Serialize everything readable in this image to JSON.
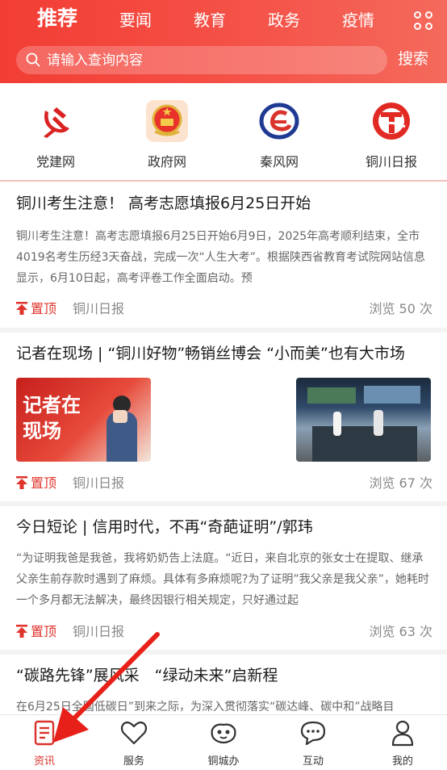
{
  "header": {
    "tabs": [
      {
        "label": "推荐",
        "active": true
      },
      {
        "label": "要闻"
      },
      {
        "label": "教育"
      },
      {
        "label": "政务"
      },
      {
        "label": "疫情"
      }
    ],
    "menu_icon": "grid-icon",
    "search": {
      "placeholder": "请输入查询内容",
      "button_label": "搜索"
    },
    "brand_color": "#f23d34"
  },
  "quick_links": [
    {
      "label": "党建网",
      "icon": "party-emblem-icon"
    },
    {
      "label": "政府网",
      "icon": "national-emblem-icon"
    },
    {
      "label": "秦风网",
      "icon": "qinfeng-logo-icon"
    },
    {
      "label": "铜川日报",
      "icon": "tongchuan-daily-logo-icon"
    }
  ],
  "articles": [
    {
      "title": "铜川考生注意！ 高考志愿填报6月25日开始",
      "summary": "铜川考生注意！高考志愿填报6月25日开始6月9日，2025年高考顺利结束，全市4019名考生历经3天奋战，完成一次“人生大考”。根据陕西省教育考试院网站信息显示，6月10日起，高考评卷工作全面启动。预",
      "pin_label": "置顶",
      "source": "铜川日报",
      "views": "浏览 50 次"
    },
    {
      "title": "记者在现场 | “铜川好物”畅销丝博会 “小而美”也有大市场",
      "image_caption": "记者在现场",
      "pin_label": "置顶",
      "source": "铜川日报",
      "views": "浏览 67 次"
    },
    {
      "title": "今日短论 | 信用时代，不再“奇葩证明”/郭玮",
      "summary": "“为证明我爸是我爸，我将奶奶告上法庭。“近日，来自北京的张女士在提取、继承父亲生前存款时遇到了麻烦。具体有多麻烦呢?为了证明”我父亲是我父亲”，她耗时一个多月都无法解决，最终因银行相关规定，只好通过起",
      "pin_label": "置顶",
      "source": "铜川日报",
      "views": "浏览 63 次"
    },
    {
      "title": "“碳路先锋”展风采　“绿动未来”启新程",
      "summary": "在6月25日全国低碳日”到来之际，为深入贯彻落实“碳达峰、碳中和”战略目"
    }
  ],
  "bottom_nav": [
    {
      "label": "资讯",
      "icon": "news-document-icon",
      "active": true
    },
    {
      "label": "服务",
      "icon": "heart-icon"
    },
    {
      "label": "铜城办",
      "icon": "city-mascot-icon"
    },
    {
      "label": "互动",
      "icon": "chat-bubble-icon"
    },
    {
      "label": "我的",
      "icon": "person-icon"
    }
  ],
  "accent_color": "#d9332c"
}
